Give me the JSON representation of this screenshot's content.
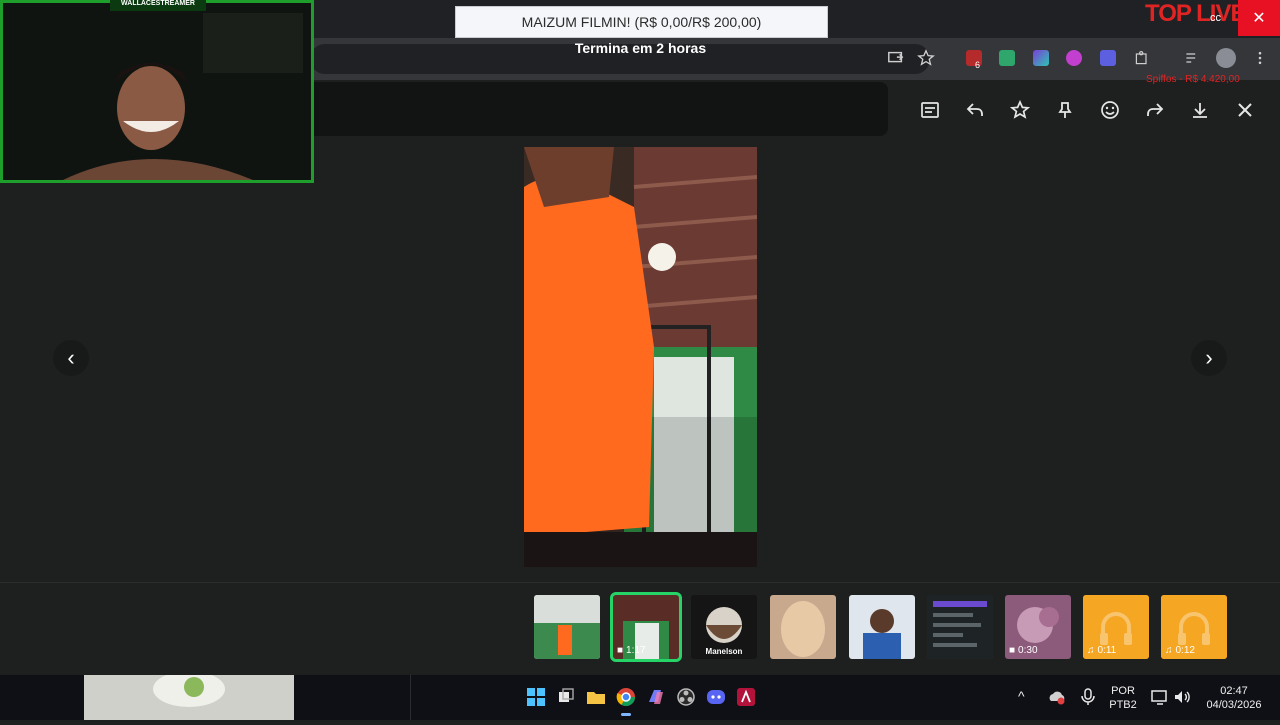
{
  "overlay": {
    "cam_tag": "WALLACESTREAMER",
    "goal_text": "MAIZUM FILMIN! (R$ 0,00/R$ 200,00)",
    "goal_sub": "Termina em 2 horas",
    "toplive": "TOP LIVEP",
    "toplive_sub": "Spiffos - R$ 4.420,00",
    "close_symbol": "✕"
  },
  "chrome": {
    "ext_badge": "6",
    "tab_counter": "cc"
  },
  "viewer": {
    "tools": [
      "message-icon",
      "reply-icon",
      "star-icon",
      "pin-icon",
      "emoji-icon",
      "forward-icon",
      "download-icon",
      "close-icon"
    ],
    "prev_symbol": "‹",
    "next_symbol": "›"
  },
  "thumbs": [
    {
      "name": "thumb-photo-1",
      "label": "",
      "active": false
    },
    {
      "name": "thumb-video-1",
      "label": "1:17",
      "active": true
    },
    {
      "name": "thumb-sticker-manelson",
      "label": "Manelson",
      "active": false
    },
    {
      "name": "thumb-photo-2",
      "label": "",
      "active": false
    },
    {
      "name": "thumb-photo-3",
      "label": "",
      "active": false
    },
    {
      "name": "thumb-screenshot",
      "label": "",
      "active": false
    },
    {
      "name": "thumb-video-2",
      "label": "0:30",
      "active": false
    },
    {
      "name": "thumb-audio-1",
      "label": "0:11",
      "active": false
    },
    {
      "name": "thumb-audio-2",
      "label": "0:12",
      "active": false
    }
  ],
  "taskbar": {
    "lang_top": "POR",
    "lang_bottom": "PTB2",
    "time": "02:47",
    "date": "04/03/2026",
    "tray_up": "^"
  },
  "colors": {
    "accent_green": "#25d366",
    "stream_red": "#e02424",
    "audio_orange": "#f5a623"
  }
}
